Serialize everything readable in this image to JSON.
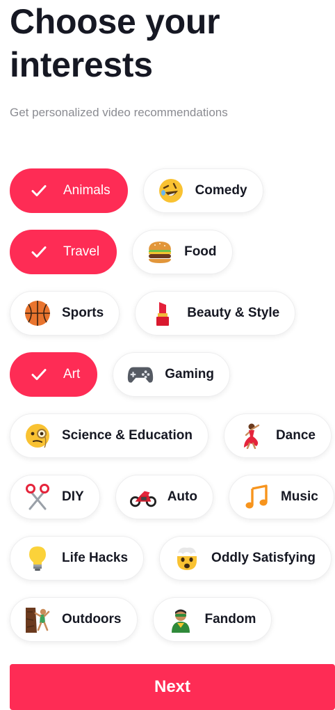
{
  "header": {
    "title_line1": "Choose your",
    "title_line2": "interests",
    "subtitle": "Get personalized video recommendations"
  },
  "colors": {
    "accent": "#fe2c55",
    "text": "#161823",
    "muted": "#8a8b91"
  },
  "interests": [
    {
      "label": "Animals",
      "selected": true,
      "icon": "check-icon"
    },
    {
      "label": "Comedy",
      "selected": false,
      "icon": "rolling-laughing-emoji-icon"
    },
    {
      "label": "Travel",
      "selected": true,
      "icon": "check-icon"
    },
    {
      "label": "Food",
      "selected": false,
      "icon": "hamburger-emoji-icon"
    },
    {
      "label": "Sports",
      "selected": false,
      "icon": "basketball-emoji-icon"
    },
    {
      "label": "Beauty & Style",
      "selected": false,
      "icon": "lipstick-emoji-icon"
    },
    {
      "label": "Art",
      "selected": true,
      "icon": "check-icon"
    },
    {
      "label": "Gaming",
      "selected": false,
      "icon": "game-controller-emoji-icon"
    },
    {
      "label": "Science & Education",
      "selected": false,
      "icon": "monocle-face-emoji-icon"
    },
    {
      "label": "Dance",
      "selected": false,
      "icon": "dancer-emoji-icon"
    },
    {
      "label": "DIY",
      "selected": false,
      "icon": "scissors-emoji-icon"
    },
    {
      "label": "Auto",
      "selected": false,
      "icon": "motorcycle-emoji-icon"
    },
    {
      "label": "Music",
      "selected": false,
      "icon": "musical-notes-emoji-icon"
    },
    {
      "label": "Life Hacks",
      "selected": false,
      "icon": "light-bulb-emoji-icon"
    },
    {
      "label": "Oddly Satisfying",
      "selected": false,
      "icon": "mind-blown-emoji-icon"
    },
    {
      "label": "Outdoors",
      "selected": false,
      "icon": "rock-climbing-emoji-icon"
    },
    {
      "label": "Fandom",
      "selected": false,
      "icon": "superhero-emoji-icon"
    }
  ],
  "footer": {
    "next_label": "Next"
  }
}
